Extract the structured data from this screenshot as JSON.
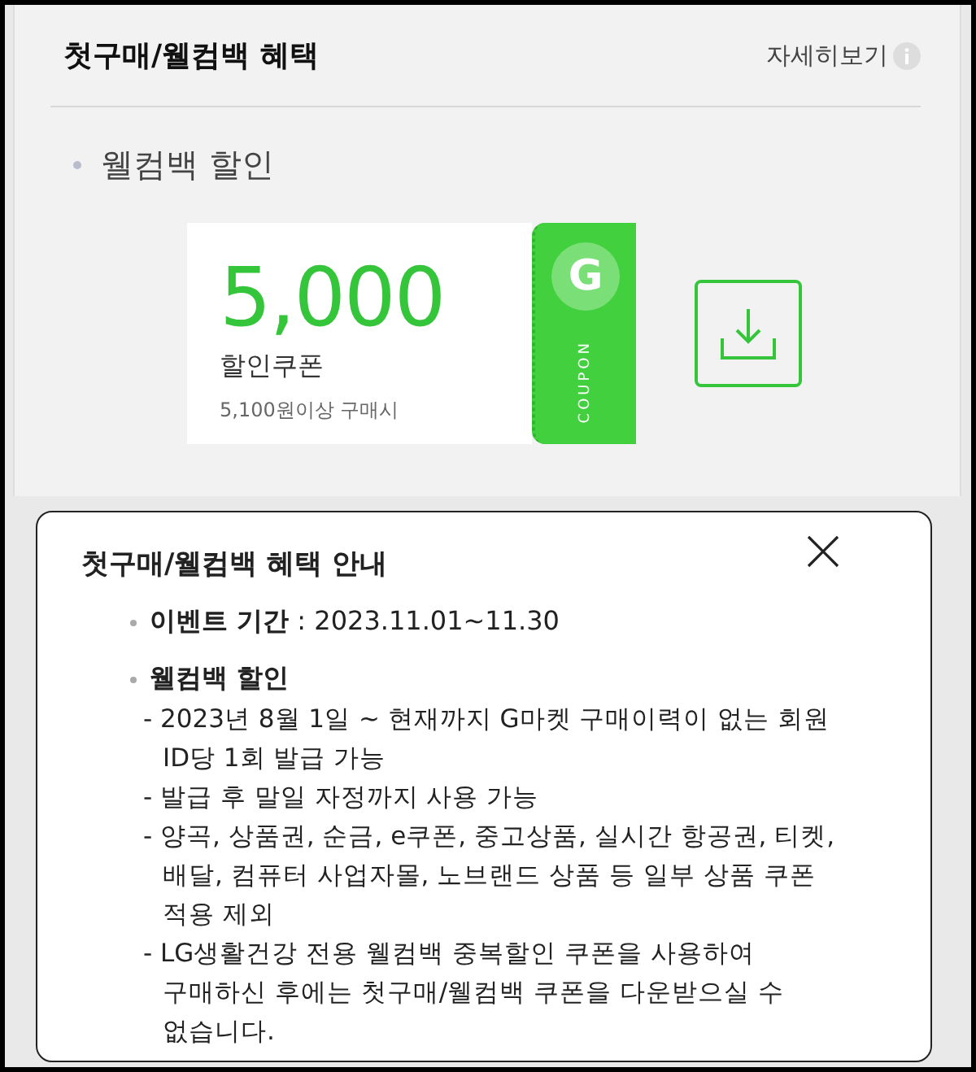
{
  "header": {
    "title": "첫구매/웰컴백 혜택",
    "detail_link": "자세히보기"
  },
  "section": {
    "title": "웰컴백 할인"
  },
  "coupon": {
    "amount": "5,000",
    "name": "할인쿠폰",
    "condition": "5,100원이상 구매시",
    "logo": "G",
    "stub_label": "COUPON"
  },
  "popup": {
    "title": "첫구매/웰컴백 혜택 안내",
    "period": {
      "label": "이벤트 기간",
      "value": ": 2023.11.01~11.30"
    },
    "benefit": {
      "title": "웰컴백 할인",
      "items": [
        "- 2023년 8월 1일 ~ 현재까지 G마켓 구매이력이 없는 회원 ID당 1회 발급 가능",
        "- 발급 후 말일 자정까지 사용 가능",
        "- 양곡, 상품권, 순금, e쿠폰, 중고상품, 실시간 항공권, 티켓, 배달, 컴퓨터 사업자몰, 노브랜드 상품 등 일부 상품 쿠폰 적용 제외",
        "- LG생활건강 전용 웰컴백 중복할인 쿠폰을 사용하여 구매하신 후에는 첫구매/웰컴백 쿠폰을 다운받으실 수 없습니다."
      ]
    }
  }
}
